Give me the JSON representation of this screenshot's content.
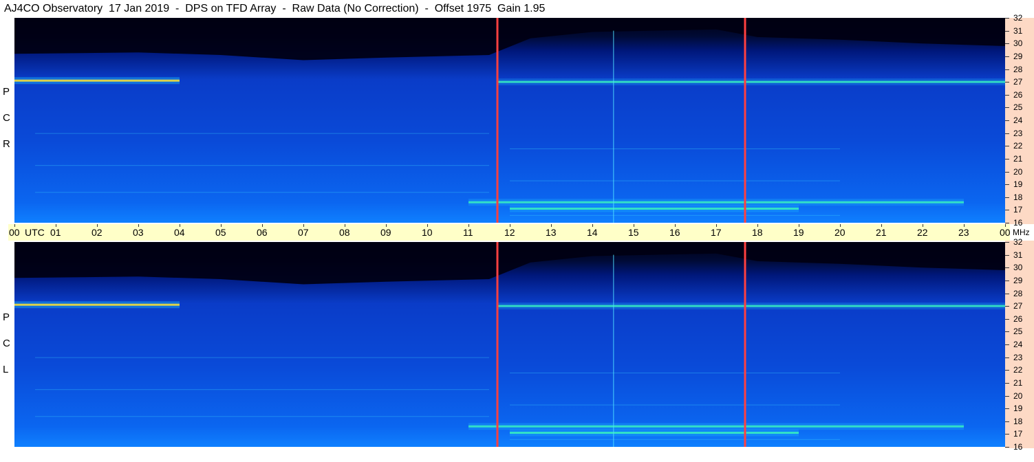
{
  "title": "AJ4CO Observatory  17 Jan 2019  -  DPS on TFD Array  -  Raw Data (No Correction)  -  Offset 1975  Gain 1.95",
  "chart_data": {
    "type": "heatmap",
    "title": "AJ4CO Observatory  17 Jan 2019  -  DPS on TFD Array  -  Raw Data (No Correction)  -  Offset 1975  Gain 1.95",
    "x_unit": "UTC",
    "y_unit": "MHz",
    "x_tick_labels": [
      "00",
      "01",
      "02",
      "03",
      "04",
      "05",
      "06",
      "07",
      "08",
      "09",
      "10",
      "11",
      "12",
      "13",
      "14",
      "15",
      "16",
      "17",
      "18",
      "19",
      "20",
      "21",
      "22",
      "23",
      "00"
    ],
    "x_range_hours": [
      0,
      24
    ],
    "y_range_mhz": [
      16,
      32
    ],
    "y_tick_labels": [
      "32",
      "31",
      "30",
      "29",
      "28",
      "27",
      "26",
      "25",
      "24",
      "23",
      "22",
      "21",
      "20",
      "19",
      "18",
      "17",
      "16"
    ],
    "panels": [
      {
        "name": "R C P",
        "polarization": "RCP"
      },
      {
        "name": "L C P",
        "polarization": "LCP"
      }
    ],
    "colormap": [
      "#000018",
      "#001a6e",
      "#0a3fd0",
      "#1a8cff",
      "#22d4ff",
      "#9cff5a",
      "#ffff00",
      "#ff8000",
      "#ff0000"
    ],
    "markers": [
      {
        "type": "vertical_line",
        "time_hours": 11.7,
        "color": "#ff4040"
      },
      {
        "type": "vertical_line",
        "time_hours": 17.7,
        "color": "#ff4040"
      }
    ],
    "features": [
      {
        "desc": "strong band",
        "freq_mhz": 27.1,
        "start_hours": 0.0,
        "end_hours": 4.0,
        "intensity": 0.85
      },
      {
        "desc": "band",
        "freq_mhz": 27.0,
        "start_hours": 11.7,
        "end_hours": 24.0,
        "intensity": 0.5
      },
      {
        "desc": "band",
        "freq_mhz": 17.6,
        "start_hours": 11.0,
        "end_hours": 23.0,
        "intensity": 0.55
      },
      {
        "desc": "band",
        "freq_mhz": 17.1,
        "start_hours": 12.0,
        "end_hours": 19.0,
        "intensity": 0.6
      }
    ]
  },
  "axis": {
    "mhz_label": "MHz",
    "utc_label": "UTC"
  },
  "polarizations": {
    "rcp_letters": [
      "R",
      "C",
      "P"
    ],
    "lcp_letters": [
      "L",
      "C",
      "P"
    ]
  }
}
